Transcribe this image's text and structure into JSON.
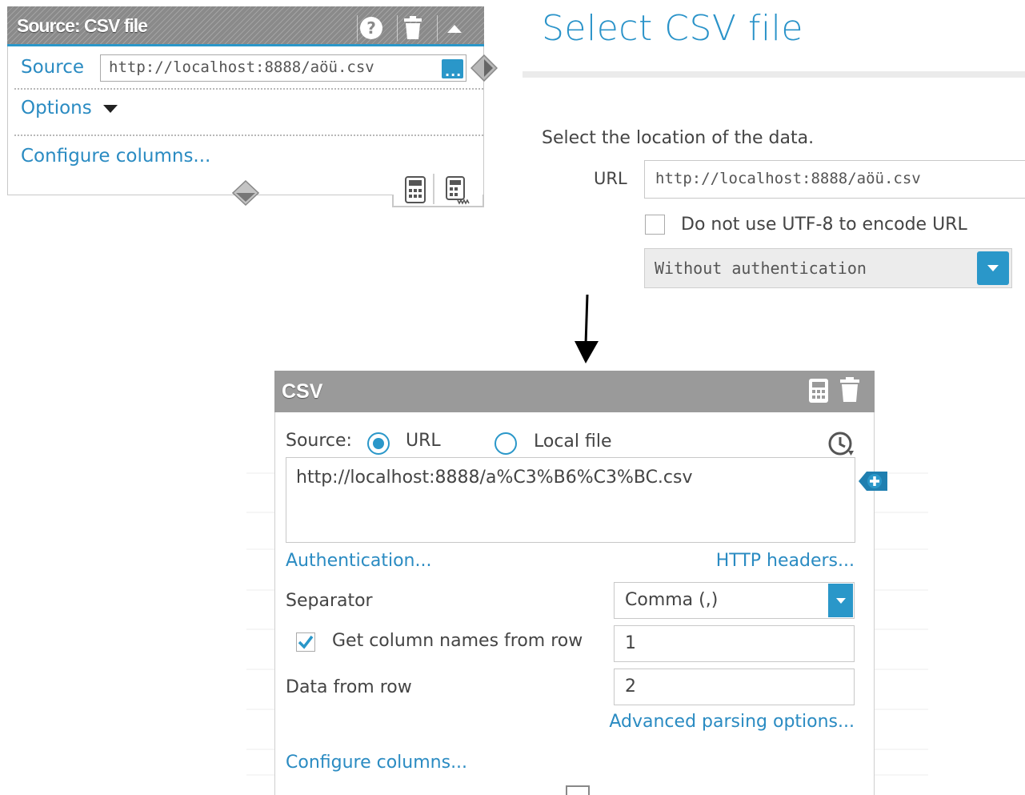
{
  "old_widget": {
    "title": "Source: CSV file",
    "icons": [
      "help-icon",
      "trash-icon",
      "collapse-up-icon"
    ],
    "source_label": "Source",
    "source_value": "http://localhost:8888/aöü.csv",
    "browse_label": "...",
    "options_label": "Options",
    "configure_link": "Configure columns...",
    "footer_icons": [
      "calculator-icon",
      "calculator-data-icon"
    ]
  },
  "dialog": {
    "title": "Select CSV file",
    "subtitle": "Select the location of the data.",
    "url_label": "URL",
    "url_value": "http://localhost:8888/aöü.csv",
    "utf8_checkbox_label": "Do not use UTF-8 to encode URL",
    "utf8_checked": false,
    "auth_selected": "Without authentication"
  },
  "csv_widget": {
    "title": "CSV",
    "header_icons": [
      "calculator-icon",
      "trash-icon"
    ],
    "source_label": "Source:",
    "radio_options": [
      {
        "label": "URL",
        "checked": true
      },
      {
        "label": "Local file",
        "checked": false
      }
    ],
    "url_value": "http://localhost:8888/a%C3%B6%C3%BC.csv",
    "auth_link": "Authentication...",
    "headers_link": "HTTP headers...",
    "separator_label": "Separator",
    "separator_value": "Comma (,)",
    "colnames_checkbox_label": "Get column names from row",
    "colnames_checked": true,
    "colnames_row": "1",
    "data_row_label": "Data from row",
    "data_row": "2",
    "advanced_link": "Advanced parsing options...",
    "configure_link": "Configure columns..."
  },
  "colors": {
    "accent": "#2a97c9",
    "link": "#2a8bc2",
    "header_gray": "#9a9a9a"
  }
}
